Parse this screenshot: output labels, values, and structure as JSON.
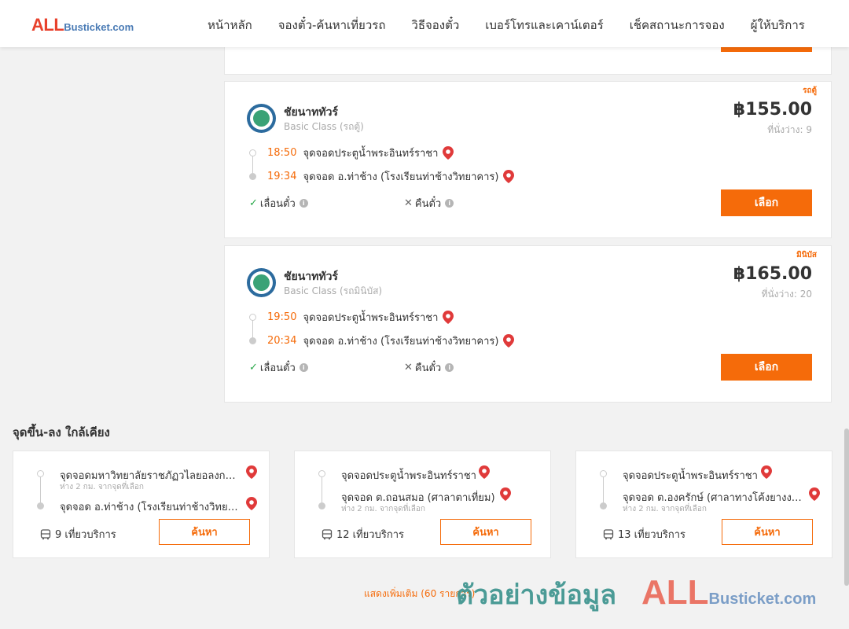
{
  "header": {
    "logo_all": "ALL",
    "logo_rest": "Busticket.com",
    "nav": [
      "หน้าหลัก",
      "จองตั๋ว-ค้นหาเที่ยวรถ",
      "วิธีจองตั๋ว",
      "เบอร์โทรและเคาน์เตอร์",
      "เช็คสถานะการจอง",
      "ผู้ให้บริการ"
    ]
  },
  "trips": [
    {
      "vehicle_type": "รถตู้",
      "operator": "ชัยนาททัวร์",
      "class": "Basic Class (รถตู้)",
      "price": "฿155.00",
      "seats": "ที่นั่งว่าง: 9",
      "depart_time": "18:50",
      "depart_stop": "จุดจอดประตูน้ำพระอินทร์ราชา",
      "arrive_time": "19:34",
      "arrive_stop": "จุดจอด อ.ท่าช้าง (โรงเรียนท่าช้างวิทยาคาร)",
      "reschedule": "เลื่อนตั๋ว",
      "refund": "คืนตั๋ว",
      "button": "เลือก"
    },
    {
      "vehicle_type": "มินิบัส",
      "operator": "ชัยนาททัวร์",
      "class": "Basic Class (รถมินิบัส)",
      "price": "฿165.00",
      "seats": "ที่นั่งว่าง: 20",
      "depart_time": "19:50",
      "depart_stop": "จุดจอดประตูน้ำพระอินทร์ราชา",
      "arrive_time": "20:34",
      "arrive_stop": "จุดจอด อ.ท่าช้าง (โรงเรียนท่าช้างวิทยาคาร)",
      "reschedule": "เลื่อนตั๋ว",
      "refund": "คืนตั๋ว",
      "button": "เลือก"
    }
  ],
  "nearby": {
    "title": "จุดขึ้น-ลง ใกล้เคียง",
    "cards": [
      {
        "from": "จุดจอดมหาวิทยาลัยราชภัฏวไลยอลงกรณ์",
        "from_dist": "ห่าง 2 กม. จากจุดที่เลือก",
        "to": "จุดจอด อ.ท่าช้าง (โรงเรียนท่าช้างวิทยาคาร)",
        "to_dist": "",
        "trips": "9 เที่ยวบริการ",
        "button": "ค้นหา"
      },
      {
        "from": "จุดจอดประตูน้ำพระอินทร์ราชา",
        "from_dist": "",
        "to": "จุดจอด ต.ถอนสมอ (ศาลาตาเที่ยม)",
        "to_dist": "ห่าง 2 กม. จากจุดที่เลือก",
        "trips": "12 เที่ยวบริการ",
        "button": "ค้นหา"
      },
      {
        "from": "จุดจอดประตูน้ำพระอินทร์ราชา",
        "from_dist": "",
        "to": "จุดจอด ต.องครักษ์ (ศาลาทางโค้งยางงาม)",
        "to_dist": "ห่าง 2 กม. จากจุดที่เลือก",
        "trips": "13 เที่ยวบริการ",
        "button": "ค้นหา"
      }
    ]
  },
  "show_more": "แสดงเพิ่มเติม (60 รายการ)",
  "watermark": {
    "text": "ตัวอย่างข้อมูล",
    "logo_all": "ALL",
    "logo_rest": "Busticket.com"
  },
  "colors": {
    "accent": "#f56b0a",
    "time": "#f56b0a",
    "logo_red": "#e8412c",
    "logo_blue": "#4a7bb5"
  }
}
